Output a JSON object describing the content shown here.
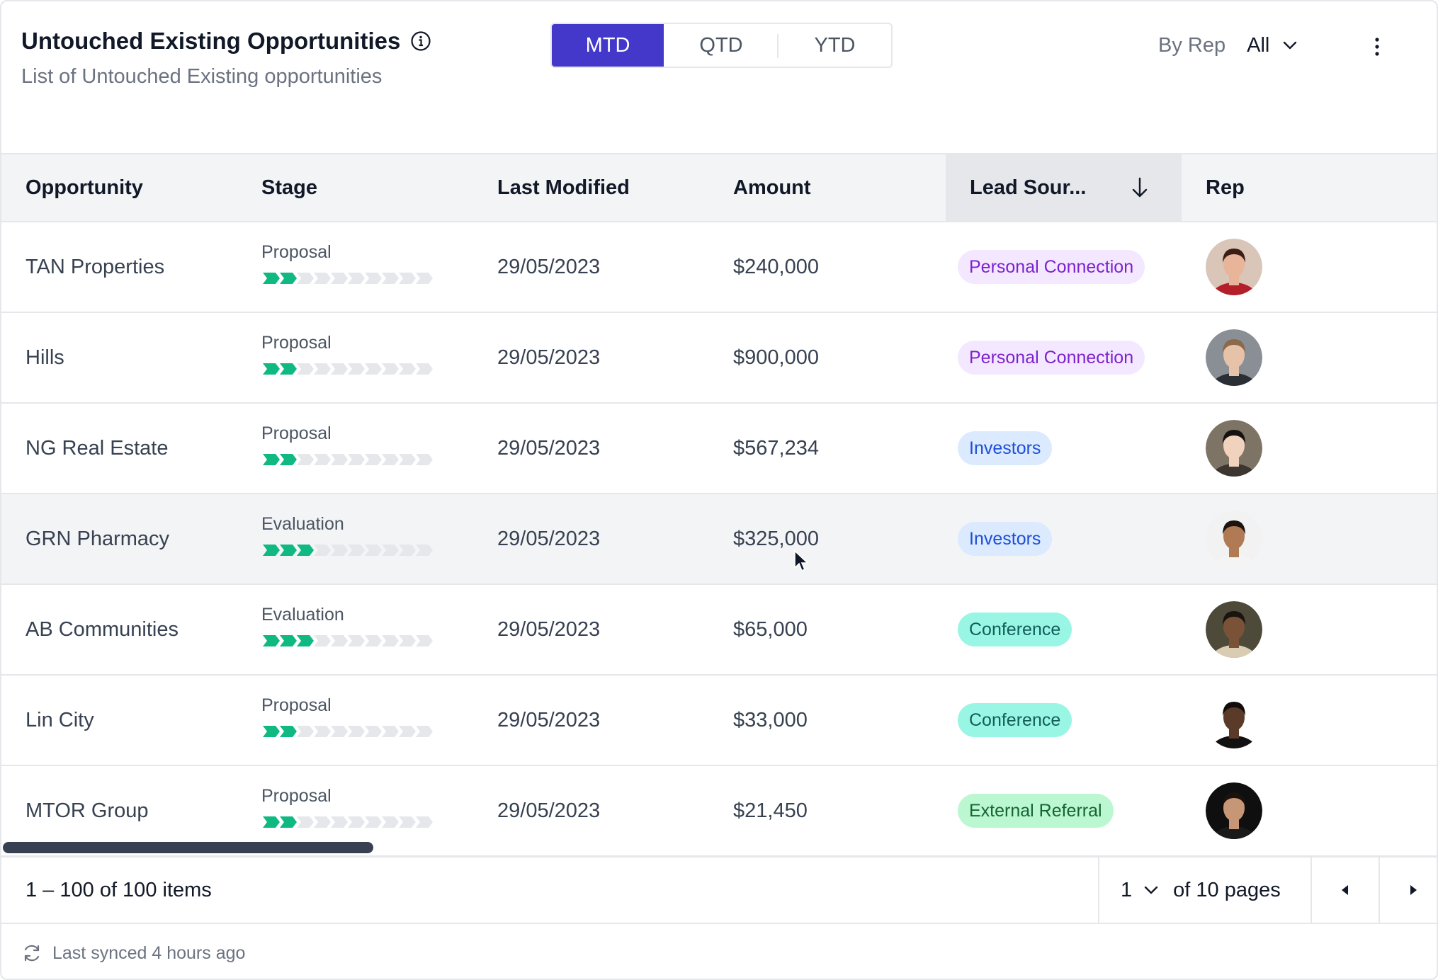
{
  "header": {
    "title": "Untouched Existing Opportunities",
    "subtitle": "List of Untouched Existing opportunities",
    "periods": [
      "MTD",
      "QTD",
      "YTD"
    ],
    "active_period": "MTD",
    "rep_filter_label": "By Rep",
    "rep_filter_value": "All"
  },
  "table": {
    "columns": [
      "Opportunity",
      "Stage",
      "Last Modified",
      "Amount",
      "Lead Sour...",
      "Rep"
    ],
    "sorted_column": "Lead Sour...",
    "sort_direction": "descending",
    "rows": [
      {
        "opportunity": "TAN Properties",
        "stage": "Proposal",
        "stage_progress": 2,
        "last_modified": "29/05/2023",
        "amount": "$240,000",
        "lead_source": "Personal Connection",
        "rep_avatar": "avatar-1"
      },
      {
        "opportunity": "Hills",
        "stage": "Proposal",
        "stage_progress": 2,
        "last_modified": "29/05/2023",
        "amount": "$900,000",
        "lead_source": "Personal Connection",
        "rep_avatar": "avatar-2"
      },
      {
        "opportunity": "NG Real Estate",
        "stage": "Proposal",
        "stage_progress": 2,
        "last_modified": "29/05/2023",
        "amount": "$567,234",
        "lead_source": "Investors",
        "rep_avatar": "avatar-3"
      },
      {
        "opportunity": "GRN Pharmacy",
        "stage": "Evaluation",
        "stage_progress": 3,
        "last_modified": "29/05/2023",
        "amount": "$325,000",
        "lead_source": "Investors",
        "rep_avatar": "avatar-4"
      },
      {
        "opportunity": "AB Communities",
        "stage": "Evaluation",
        "stage_progress": 3,
        "last_modified": "29/05/2023",
        "amount": "$65,000",
        "lead_source": "Conference",
        "rep_avatar": "avatar-5"
      },
      {
        "opportunity": "Lin City",
        "stage": "Proposal",
        "stage_progress": 2,
        "last_modified": "29/05/2023",
        "amount": "$33,000",
        "lead_source": "Conference",
        "rep_avatar": "avatar-6"
      },
      {
        "opportunity": "MTOR Group",
        "stage": "Proposal",
        "stage_progress": 2,
        "last_modified": "29/05/2023",
        "amount": "$21,450",
        "lead_source": "External Referral",
        "rep_avatar": "avatar-7"
      }
    ]
  },
  "lead_source_colors": {
    "Personal Connection": {
      "bg": "#f3e8ff",
      "fg": "#7e22ce"
    },
    "Investors": {
      "bg": "#dbeafe",
      "fg": "#1d4ed8"
    },
    "Conference": {
      "bg": "#99f6e4",
      "fg": "#115e59"
    },
    "External Referral": {
      "bg": "#bbf7d0",
      "fg": "#166534"
    }
  },
  "colors": {
    "accent": "#4338ca",
    "progress_done": "#10b981",
    "progress_todo": "#e5e7eb"
  },
  "pagination": {
    "items_text": "1 – 100 of 100 items",
    "current_page": "1",
    "pages_text": "of 10 pages"
  },
  "footer": {
    "sync_text": "Last synced 4 hours ago"
  }
}
